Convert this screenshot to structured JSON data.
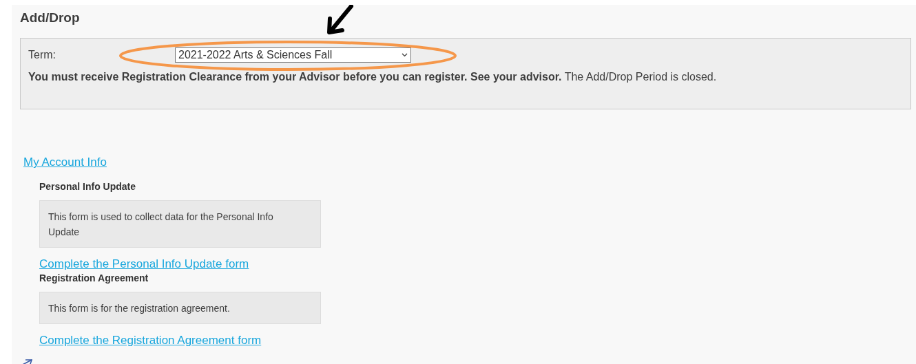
{
  "page": {
    "title": "Add/Drop"
  },
  "term": {
    "label": "Term:",
    "value": "2021-2022 Arts & Sciences Fall"
  },
  "notice": "**You must receive Registration Clearance from your Advisor before you can register. See your advisor.** The Add/Drop Period is closed.",
  "account_link": "My Account Info",
  "forms": [
    {
      "heading": "Personal Info Update",
      "description": "This form is used to collect data for the Personal Info Update",
      "link": "Complete the Personal Info Update form"
    },
    {
      "heading": "Registration Agreement",
      "description": "This form is for the registration agreement.",
      "link": "Complete the Registration Agreement form"
    }
  ]
}
